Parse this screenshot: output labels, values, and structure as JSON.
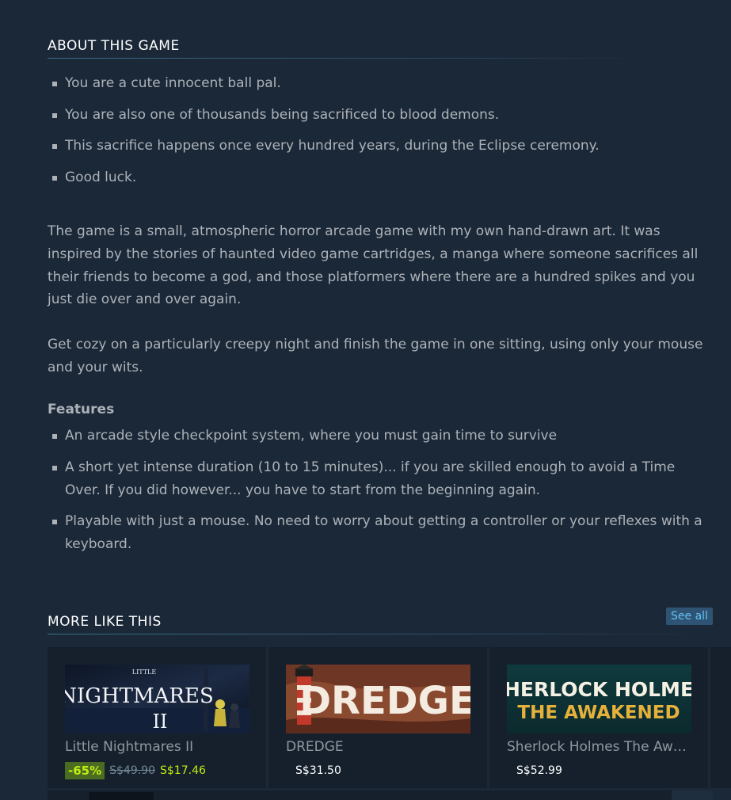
{
  "about": {
    "heading": "ABOUT THIS GAME",
    "bullets": [
      "You are a cute innocent ball pal.",
      "You are also one of thousands being sacrificed to blood demons.",
      "This sacrifice happens once every hundred years, during the Eclipse ceremony.",
      "Good luck."
    ],
    "paragraph1": "The game is a small, atmospheric horror arcade game with my own hand-drawn art. It was inspired by the stories of haunted video game cartridges, a manga where someone sacrifices all their friends to become a god, and those platformers where there are a hundred spikes and you just die over and over again.",
    "paragraph2": "Get cozy on a particularly creepy night and finish the game in one sitting, using only your mouse and your wits.",
    "features_title": "Features",
    "features": [
      "An arcade style checkpoint system, where you must gain time to survive",
      "A short yet intense duration (10 to 15 minutes)... if you are skilled enough to avoid a Time Over. If you did however... you have to start from the beginning again.",
      "Playable with just a mouse. No need to worry about getting a controller or your reflexes with a keyboard."
    ]
  },
  "more": {
    "heading": "MORE LIKE THIS",
    "see_all": "See all",
    "games": [
      {
        "name": "Little Nightmares II",
        "discount": "-65%",
        "original_price": "S$49.90",
        "final_price": "S$17.46",
        "logo_line1": "LITTLE",
        "logo_line2": "NIGHTMARES",
        "logo_line3": "II"
      },
      {
        "name": "DREDGE",
        "price": "S$31.50",
        "logo": "DREDGE"
      },
      {
        "name": "Sherlock Holmes The Awakened",
        "price": "S$52.99",
        "logo_line1": "SHERLOCK HOLMES",
        "logo_line2": "THE AWAKENED"
      }
    ]
  },
  "colors": {
    "background": "#1b2838",
    "text": "#acb2b8",
    "heading": "#ffffff",
    "discount_bg": "#4c6b22",
    "discount_text": "#beee11",
    "link": "#66c0f4"
  }
}
